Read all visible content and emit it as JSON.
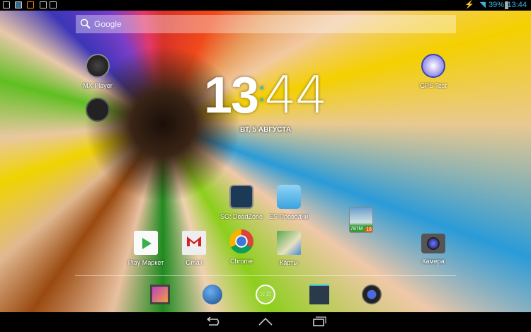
{
  "status_bar": {
    "time": "13:44",
    "battery": "39%",
    "notifications": [
      "screenshot-icon",
      "deadzone-icon",
      "mx-icon",
      "download-done-icon",
      "play-store-update-icon"
    ]
  },
  "search": {
    "placeholder": "Google"
  },
  "clock": {
    "hours": "13",
    "minutes": "44",
    "date": "ВТ, 5 АВГУСТА"
  },
  "apps": [
    {
      "label": "MX Player"
    },
    {
      "label": ""
    },
    {
      "label": "GPS Test"
    },
    {
      "label": "SG: DeadZone"
    },
    {
      "label": "ES Проводник"
    },
    {
      "label": "Play Маркет"
    },
    {
      "label": "Gmail"
    },
    {
      "label": "Chrome"
    },
    {
      "label": "Карты"
    },
    {
      "label": "Камера"
    }
  ],
  "widget": {
    "memory": "787M",
    "count": "16"
  },
  "dock": [
    "gallery",
    "browser",
    "all-apps",
    "settings",
    "music"
  ],
  "colors": {
    "accent": "#33b5e5"
  }
}
